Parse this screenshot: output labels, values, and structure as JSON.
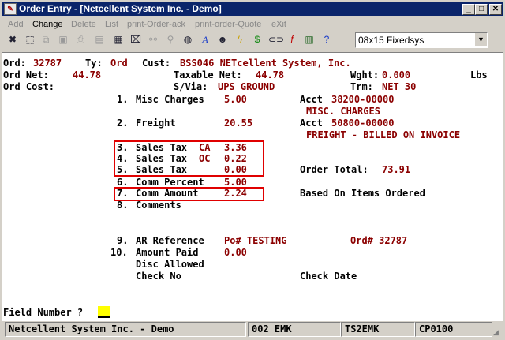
{
  "window": {
    "title": "Order Entry - [Netcellent System Inc. - Demo]"
  },
  "title_buttons": {
    "minimize": "_",
    "maximize": "□",
    "close": "✕"
  },
  "menu": [
    {
      "label": "Add",
      "enabled": false
    },
    {
      "label": "Change",
      "enabled": true
    },
    {
      "label": "Delete",
      "enabled": false
    },
    {
      "label": "List",
      "enabled": false
    },
    {
      "label": "print-Order-ack",
      "enabled": false
    },
    {
      "label": "print-order-Quote",
      "enabled": false
    },
    {
      "label": "eXit",
      "enabled": false
    }
  ],
  "toolbar": {
    "icons": [
      "close-icon",
      "select-icon",
      "copy-icon",
      "save-icon",
      "print-icon",
      "list-icon",
      "lookup-icon",
      "delete-icon",
      "binoculars-icon",
      "magnifier-icon",
      "globe-icon",
      "font-icon",
      "person-icon",
      "lightning-icon",
      "currency-icon",
      "link-icon",
      "function-icon",
      "notes-icon",
      "help-icon"
    ],
    "font_select": "08x15 Fixedsys"
  },
  "screen": {
    "order": {
      "label": "Ord:",
      "value": "32787"
    },
    "type": {
      "label": "Ty:",
      "value": "Ord"
    },
    "customer": {
      "label": "Cust:",
      "value": "BSS046 NETcellent System, Inc."
    },
    "ord_net": {
      "label": "Ord Net:",
      "value": "44.78"
    },
    "taxable_net": {
      "label": "Taxable Net:",
      "value": "44.78"
    },
    "weight": {
      "label": "Wght:",
      "value": "0.000",
      "unit": "Lbs"
    },
    "ord_cost": {
      "label": "Ord Cost:"
    },
    "ship_via": {
      "label": "S/Via:",
      "value": "UPS GROUND"
    },
    "terms": {
      "label": "Trm:",
      "value": "NET 30"
    },
    "misc_charges": {
      "num": "1.",
      "label": "Misc Charges",
      "value": "5.00"
    },
    "acct1": {
      "label": "Acct",
      "value": "38200-00000",
      "desc": "MISC. CHARGES"
    },
    "freight": {
      "num": "2.",
      "label": "Freight",
      "value": "20.55"
    },
    "acct2": {
      "label": "Acct",
      "value": "50800-00000",
      "desc": "FREIGHT - BILLED ON INVOICE"
    },
    "tax_ca": {
      "num": "3.",
      "label": "Sales Tax",
      "code": "CA",
      "value": "3.36"
    },
    "tax_oc": {
      "num": "4.",
      "label": "Sales Tax",
      "code": "OC",
      "value": "0.22"
    },
    "tax_3": {
      "num": "5.",
      "label": "Sales Tax",
      "value": "0.00"
    },
    "order_total": {
      "label": "Order Total:",
      "value": "73.91"
    },
    "comm_percent": {
      "num": "6.",
      "label": "Comm Percent",
      "value": "5.00"
    },
    "comm_amount": {
      "num": "7.",
      "label": "Comm Amount",
      "value": "2.24"
    },
    "based_on": "Based On Items Ordered",
    "comments": {
      "num": "8.",
      "label": "Comments"
    },
    "ar_reference": {
      "num": "9.",
      "label": "AR Reference",
      "value": "Po# TESTING"
    },
    "ord_ref": "Ord# 32787",
    "amount_paid": {
      "num": "10.",
      "label": "Amount Paid",
      "value": "0.00"
    },
    "disc_allowed": "Disc Allowed",
    "check_no": "Check No",
    "check_date": "Check Date",
    "prompt": "Field Number ?"
  },
  "status": {
    "company": "Netcellent System Inc. - Demo",
    "user": "002 EMK",
    "terminal": "TS2EMK",
    "code": "CP0100"
  },
  "colors": {
    "label": "#000000",
    "value": "#8b0000",
    "highlight_box": "#e00000",
    "title_bar": "#0a246a"
  }
}
